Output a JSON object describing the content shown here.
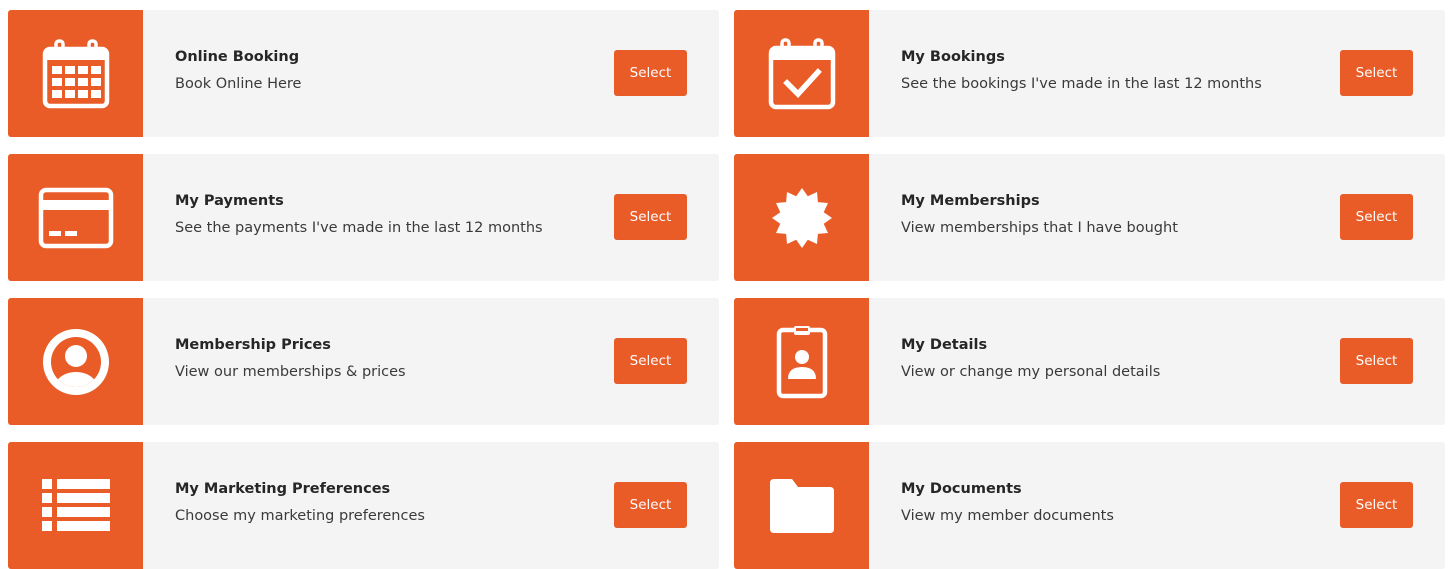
{
  "cards": [
    {
      "title": "Online Booking",
      "desc": "Book Online Here",
      "button": "Select",
      "icon": "calendar-icon"
    },
    {
      "title": "My Bookings",
      "desc": "See the bookings I've made in the last 12 months",
      "button": "Select",
      "icon": "calendar-check-icon"
    },
    {
      "title": "My Payments",
      "desc": "See the payments I've made in the last 12 months",
      "button": "Select",
      "icon": "credit-card-icon"
    },
    {
      "title": "My Memberships",
      "desc": "View memberships that I have bought",
      "button": "Select",
      "icon": "badge-icon"
    },
    {
      "title": "Membership Prices",
      "desc": "View our memberships & prices",
      "button": "Select",
      "icon": "user-circle-icon"
    },
    {
      "title": "My Details",
      "desc": "View or change my personal details",
      "button": "Select",
      "icon": "id-badge-icon"
    },
    {
      "title": "My Marketing Preferences",
      "desc": "Choose my marketing preferences",
      "button": "Select",
      "icon": "list-icon"
    },
    {
      "title": "My Documents",
      "desc": "View my member documents",
      "button": "Select",
      "icon": "folder-icon"
    }
  ],
  "colors": {
    "accent": "#e95b27",
    "card_bg": "#f4f4f4",
    "title": "#262626",
    "text": "#3a3a3a"
  }
}
